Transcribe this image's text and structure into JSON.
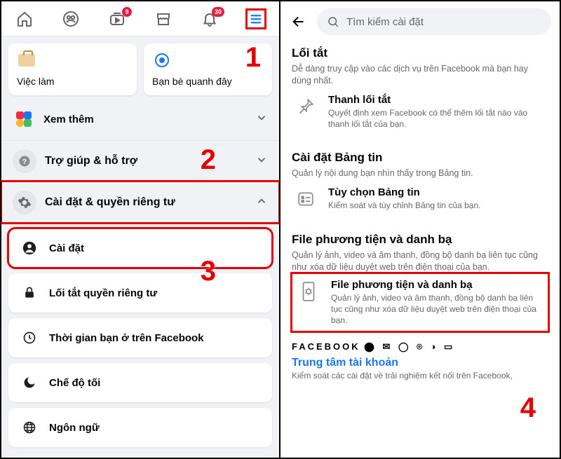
{
  "left": {
    "nav": {
      "badge_watch": "9",
      "badge_notif": "30"
    },
    "cards": {
      "jobs": "Việc làm",
      "nearby": "Bạn bè quanh đây"
    },
    "see_more": "Xem thêm",
    "help": "Trợ giúp & hỗ trợ",
    "settings_privacy": "Cài đặt & quyền riêng tư",
    "items": {
      "settings": "Cài đặt",
      "privacy_shortcut": "Lối tắt quyền riêng tư",
      "time_on_fb": "Thời gian bạn ở trên Facebook",
      "dark_mode": "Chế độ tối",
      "language": "Ngôn ngữ"
    },
    "annot": {
      "n1": "1",
      "n2": "2",
      "n3": "3"
    }
  },
  "right": {
    "search_placeholder": "Tìm kiếm cài đặt",
    "shortcut": {
      "title": "Lối tắt",
      "sub": "Dễ dàng truy cập vào các dịch vụ trên Facebook mà bạn hay dùng nhất.",
      "item_title": "Thanh lối tắt",
      "item_sub": "Quyết định xem Facebook có thể thêm lối tắt nào vào thanh lối tắt của bạn."
    },
    "feed": {
      "title": "Cài đặt Bảng tin",
      "sub": "Quản lý nội dung bạn nhìn thấy trong Bảng tin.",
      "item_title": "Tùy chọn Bảng tin",
      "item_sub": "Kiểm soát và tùy chỉnh Bảng tin của bạn."
    },
    "media": {
      "title": "File phương tiện và danh bạ",
      "sub": "Quản lý ảnh, video và âm thanh, đồng bộ danh bạ liên tục cũng như xóa dữ liệu duyệt web trên điện thoại của bạn.",
      "item_title": "File phương tiện và danh bạ",
      "item_sub": "Quản lý ảnh, video và âm thanh, đồng bộ danh bạ liên tục cũng như xóa dữ liệu duyệt web trên điện thoại của bạn."
    },
    "meta": "FACEBOOK",
    "account_center": "Trung tâm tài khoản",
    "account_center_sub": "Kiểm soát các cài đặt về trải nghiệm kết nối trên Facebook,",
    "annot": {
      "n4": "4"
    }
  }
}
